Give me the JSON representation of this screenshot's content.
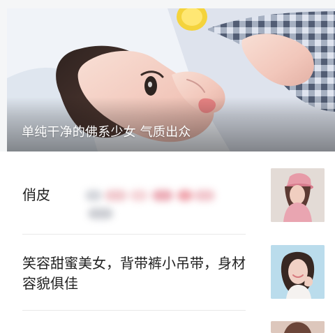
{
  "hero": {
    "caption": "单纯干净的佛系少女 气质出众"
  },
  "articles": [
    {
      "title": "俏皮",
      "thumb_icon": "portrait-pink-hat-icon"
    },
    {
      "title": "笑容甜蜜美女，背带裤小吊带，身材容貌俱佳",
      "thumb_icon": "portrait-smiling-woman-icon"
    },
    {
      "title": "",
      "thumb_icon": "portrait-partial-icon"
    }
  ],
  "colors": {
    "page_bg": "#f5f6f7",
    "card_bg": "#ffffff",
    "title_text": "#222222",
    "divider": "#e8e8e8",
    "hero_text": "#ffffff"
  }
}
